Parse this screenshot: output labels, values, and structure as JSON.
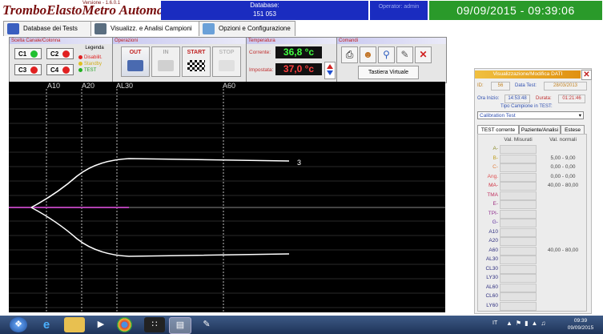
{
  "titlebar": {
    "app_title": "TromboElastoMetro Automatizzato",
    "version": "Versione - 1.6.0.1",
    "database_label": "Database:",
    "database_value": "151 053",
    "operator": "Operator: admin",
    "datetime": "09/09/2015 - 09:39:06"
  },
  "tabs": [
    {
      "label": "Database dei Tests",
      "icon": "database-icon"
    },
    {
      "label": "Visualizz. e Analisi Campioni",
      "icon": "truck-icon"
    },
    {
      "label": "Opzioni e Configurazione",
      "icon": "gears-icon"
    }
  ],
  "channels": {
    "title": "Scelta Canale/Colonna",
    "buttons": [
      {
        "label": "C1",
        "status": "green"
      },
      {
        "label": "C2",
        "status": "red"
      },
      {
        "label": "C3",
        "status": "red"
      },
      {
        "label": "C4",
        "status": "red"
      }
    ],
    "legend_title": "Legenda",
    "legend": [
      {
        "label": "Disabilit.",
        "color": "#e02020"
      },
      {
        "label": "Standby",
        "color": "#e0c020"
      },
      {
        "label": "TEST",
        "color": "#20b020"
      }
    ]
  },
  "operations": {
    "title": "Operazioni",
    "buttons": [
      {
        "label": "OUT",
        "enabled": true
      },
      {
        "label": "IN",
        "enabled": false
      },
      {
        "label": "START",
        "enabled": true
      },
      {
        "label": "STOP",
        "enabled": false
      }
    ]
  },
  "temperature": {
    "title": "Temperatura",
    "current_label": "Corrente:",
    "current_value": "36,8 °c",
    "set_label": "Impostata:",
    "set_value": "37,0 °c",
    "current_color": "#40ff40",
    "set_color": "#ff4040"
  },
  "commands": {
    "title": "Comandi",
    "icons": [
      "print-icon",
      "users-icon",
      "chart-zoom-icon",
      "edit-icon",
      "close-icon"
    ],
    "virtual_keyboard": "Tastiera Virtuale"
  },
  "chart": {
    "markers": [
      "A10",
      "A20",
      "AL30",
      "A60"
    ],
    "trace_label": "3"
  },
  "detail_panel": {
    "title": "Visualizzazione/Modifica DATI",
    "id_label": "ID:",
    "id_value": "56",
    "date_label": "Data Test:",
    "date_value": "28/03/2013",
    "start_label": "Ora Inizio:",
    "start_value": "14:53:48",
    "duration_label": "Durata:",
    "duration_value": "01:21:46",
    "sample_type_label": "Tipo Campione in TEST:",
    "sample_type_value": "Calibration Test",
    "subtabs": [
      "TEST corrente",
      "Paziente/Analisi",
      "Estese"
    ],
    "col_measured": "Val. Misurati",
    "col_normal": "Val. normali",
    "rows": [
      {
        "label": "A-",
        "normal": "",
        "color": "#8a8a2a"
      },
      {
        "label": "B-",
        "normal": "5,00 - 9,00",
        "color": "#c0a020"
      },
      {
        "label": "C-",
        "normal": "0,00 - 0,00",
        "color": "#e08040"
      },
      {
        "label": "Ang.",
        "normal": "0,00 - 0,00",
        "color": "#e05050"
      },
      {
        "label": "MA-",
        "normal": "40,00 - 80,00",
        "color": "#d03040"
      },
      {
        "label": "TMA",
        "normal": "",
        "color": "#c03060"
      },
      {
        "label": "E-",
        "normal": "",
        "color": "#a03080"
      },
      {
        "label": "TPI-",
        "normal": "",
        "color": "#903090"
      },
      {
        "label": "G-",
        "normal": "",
        "color": "#6030a0"
      },
      {
        "label": "A10",
        "normal": "",
        "color": "#303080"
      },
      {
        "label": "A20",
        "normal": "",
        "color": "#303080"
      },
      {
        "label": "A60",
        "normal": "40,00 - 80,00",
        "color": "#303080"
      },
      {
        "label": "AL30",
        "normal": "",
        "color": "#303080"
      },
      {
        "label": "CL30",
        "normal": "",
        "color": "#303080"
      },
      {
        "label": "LY30",
        "normal": "",
        "color": "#303080"
      },
      {
        "label": "AL60",
        "normal": "",
        "color": "#303080"
      },
      {
        "label": "CL60",
        "normal": "",
        "color": "#303080"
      },
      {
        "label": "LY60",
        "normal": "",
        "color": "#303080"
      }
    ]
  },
  "taskbar": {
    "apps": [
      "windows-start-icon",
      "ie-icon",
      "folder-icon",
      "media-player-icon",
      "chrome-icon",
      "blackberry-icon",
      "app-active-icon",
      "paint-icon"
    ],
    "tray_lang": "IT",
    "time": "09:39",
    "date": "09/09/2015"
  }
}
